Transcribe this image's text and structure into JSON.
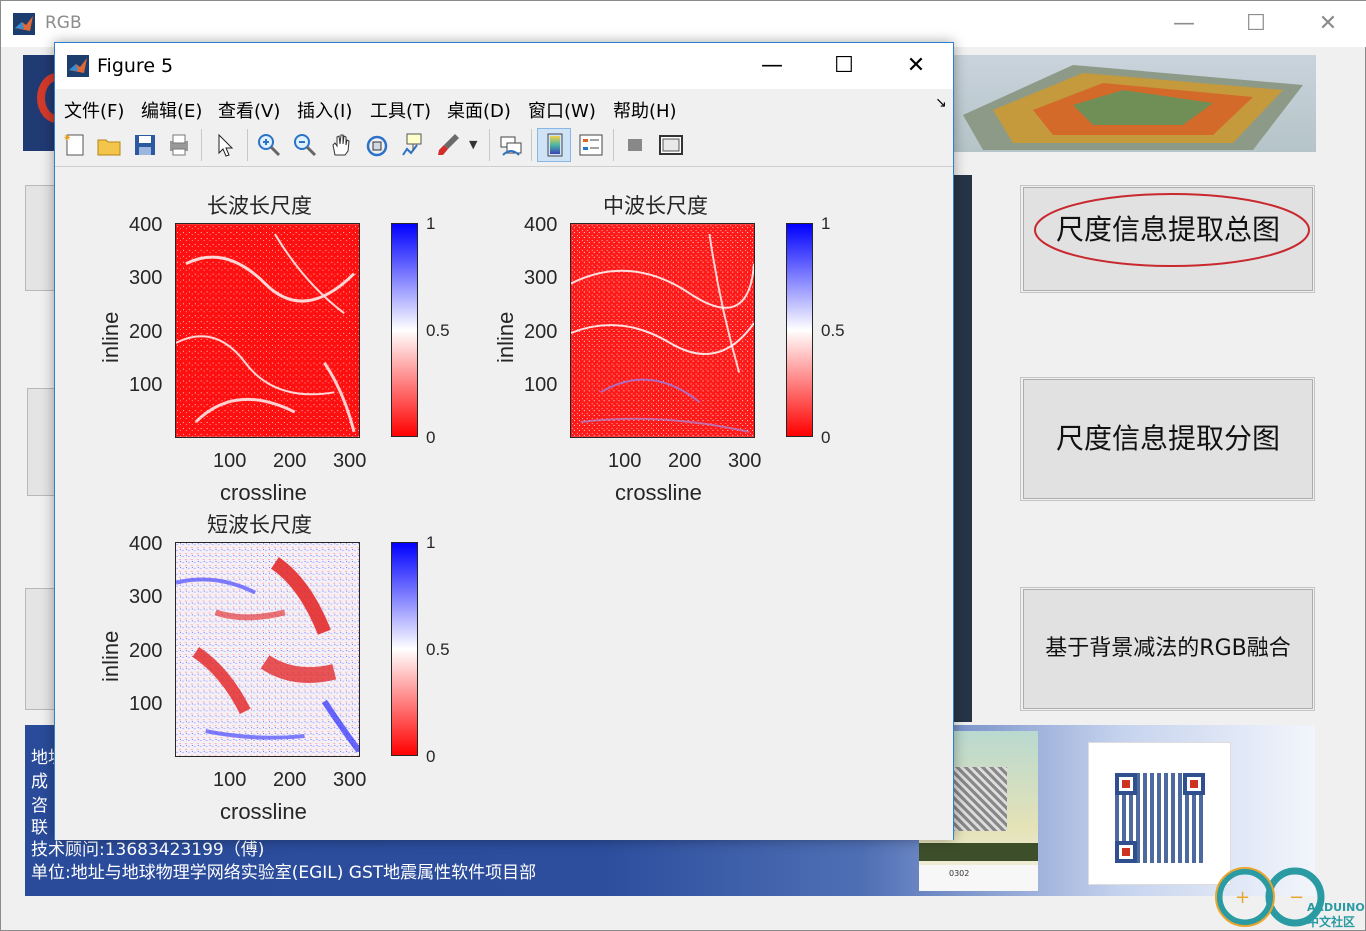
{
  "main_window": {
    "title": "RGB",
    "buttons": {
      "total_map": "尺度信息提取总图",
      "split_map": "尺度信息提取分图",
      "rgb_fusion": "基于背景减法的RGB融合"
    },
    "footer": {
      "line1": "地址",
      "line2": "成",
      "line3": "咨",
      "line4": "联",
      "line5": "技术顾问:13683423199（傅)",
      "line6": "单位:地址与地球物理学网络实验室(EGIL) GST地震属性软件项目部"
    },
    "watermark": {
      "brand": "ARDUINO",
      "sub": "中文社区"
    },
    "poster_caption": "0302"
  },
  "figure_window": {
    "title": "Figure 5",
    "menu": [
      "文件(F)",
      "编辑(E)",
      "查看(V)",
      "插入(I)",
      "工具(T)",
      "桌面(D)",
      "窗口(W)",
      "帮助(H)"
    ],
    "toolbar_icons": [
      "new-figure-icon",
      "open-icon",
      "save-icon",
      "print-icon",
      "pointer-icon",
      "zoom-in-icon",
      "zoom-out-icon",
      "pan-hand-icon",
      "rotate-3d-icon",
      "data-cursor-icon",
      "brush-icon",
      "dropdown-arrow-icon",
      "link-plot-icon",
      "colorbar-icon",
      "legend-icon",
      "hide-plot-tools-icon",
      "show-plot-tools-icon"
    ]
  },
  "chart_data": [
    {
      "type": "heatmap",
      "title": "长波长尺度",
      "xlabel": "crossline",
      "ylabel": "inline",
      "x_ticks": [
        "100",
        "200",
        "300"
      ],
      "y_ticks": [
        "400",
        "300",
        "200",
        "100"
      ],
      "colorbar_ticks": [
        "1",
        "0.5",
        "0"
      ],
      "colormap": [
        "#0000ff",
        "#ffffff",
        "#ff0000"
      ],
      "clim": [
        0,
        1
      ],
      "xlim": [
        0,
        310
      ],
      "ylim": [
        0,
        400
      ],
      "dominant_color": "#ff0000"
    },
    {
      "type": "heatmap",
      "title": "中波长尺度",
      "xlabel": "crossline",
      "ylabel": "inline",
      "x_ticks": [
        "100",
        "200",
        "300"
      ],
      "y_ticks": [
        "400",
        "300",
        "200",
        "100"
      ],
      "colorbar_ticks": [
        "1",
        "0.5",
        "0"
      ],
      "colormap": [
        "#0000ff",
        "#ffffff",
        "#ff0000"
      ],
      "clim": [
        0,
        1
      ],
      "xlim": [
        0,
        310
      ],
      "ylim": [
        0,
        400
      ],
      "dominant_color": "#ff0000"
    },
    {
      "type": "heatmap",
      "title": "短波长尺度",
      "xlabel": "crossline",
      "ylabel": "inline",
      "x_ticks": [
        "100",
        "200",
        "300"
      ],
      "y_ticks": [
        "400",
        "300",
        "200",
        "100"
      ],
      "colorbar_ticks": [
        "1",
        "0.5",
        "0"
      ],
      "colormap": [
        "#0000ff",
        "#ffffff",
        "#ff0000"
      ],
      "clim": [
        0,
        1
      ],
      "xlim": [
        0,
        310
      ],
      "ylim": [
        0,
        400
      ],
      "dominant_color": "#ffffff"
    }
  ]
}
